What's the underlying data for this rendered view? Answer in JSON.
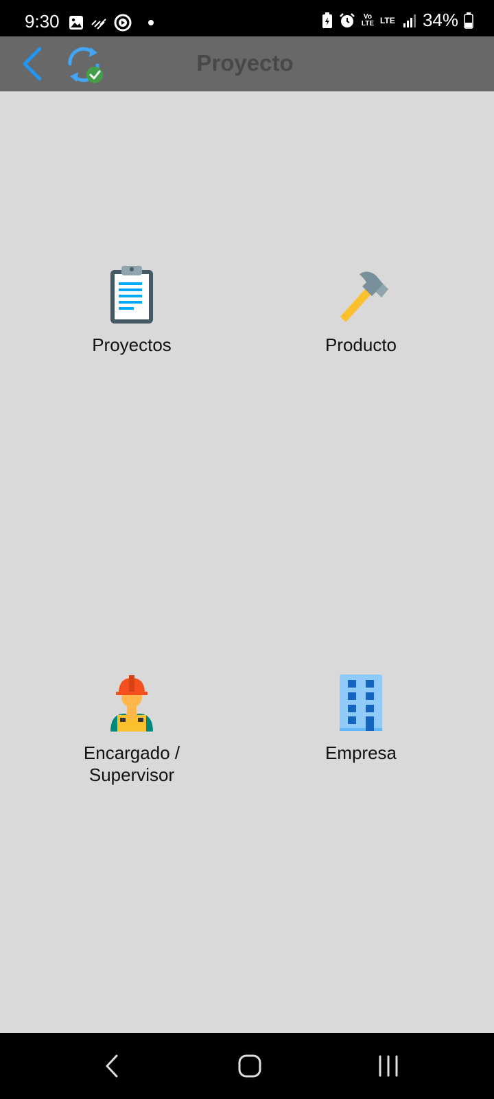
{
  "status_bar": {
    "time": "9:30",
    "battery_percent": "34%",
    "left_icons": [
      "image-icon",
      "signal-sync-icon",
      "play-circle-icon",
      "dot-icon"
    ],
    "right_icons": [
      "battery-saver-icon",
      "alarm-icon",
      "volte-icon",
      "lte-icon",
      "signal-icon",
      "battery-icon"
    ],
    "volte_label": "Vo LTE",
    "lte_label": "LTE"
  },
  "app_bar": {
    "title": "Proyecto",
    "accent_color": "#2196f3"
  },
  "grid": {
    "items": [
      {
        "label": "Proyectos",
        "icon": "clipboard-icon"
      },
      {
        "label": "Producto",
        "icon": "hammer-icon"
      },
      {
        "label": "Encargado /\nSupervisor",
        "icon": "worker-icon"
      },
      {
        "label": "Empresa",
        "icon": "building-icon"
      }
    ]
  },
  "nav_bar": {
    "buttons": [
      "back",
      "home",
      "recents"
    ]
  }
}
